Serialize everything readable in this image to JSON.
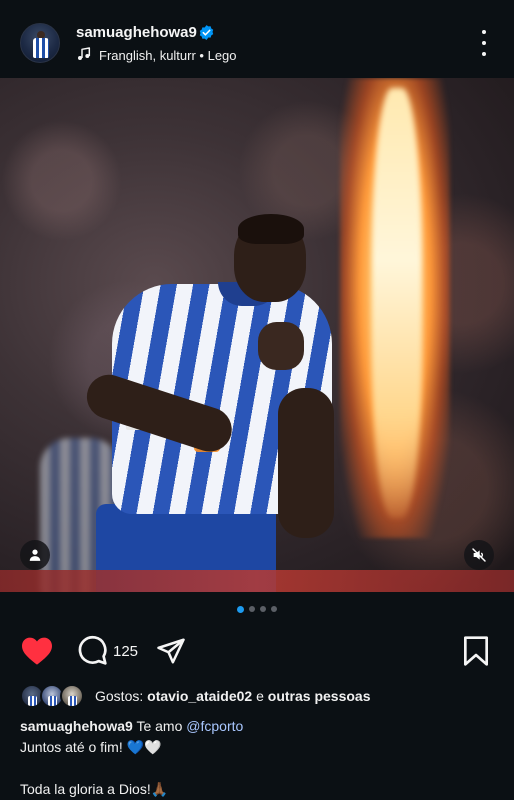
{
  "header": {
    "username": "samuaghehowa9",
    "audio_text": "Franglish, kulturr • Lego"
  },
  "carousel": {
    "total": 4,
    "active_index": 0
  },
  "actions": {
    "comment_count": "125"
  },
  "likes": {
    "prefix": "Gostos: ",
    "first_liker": "otavio_ataide02",
    "connector": " e ",
    "others": "outras pessoas"
  },
  "caption": {
    "username": "samuaghehowa9",
    "text1": "Te amo ",
    "mention": "@fcporto",
    "line2": "Juntos até o fim! 💙🤍",
    "line4": "Toda la gloria a Dios!🙏🏾"
  },
  "colors": {
    "background": "#0b1014",
    "like_red": "#ff3040",
    "verified_blue": "#0095f6",
    "active_dot": "#1d9bf0",
    "mention": "#a9c7ff"
  }
}
